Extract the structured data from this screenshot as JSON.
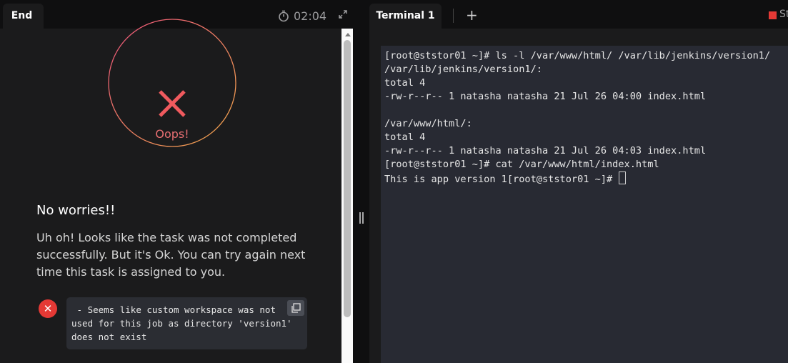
{
  "left_panel": {
    "tab_label": "End",
    "timer": "02:04",
    "result": {
      "status_text": "Oops!",
      "heading": "No worries!!",
      "message": "Uh oh! Looks like the task was not completed successfully. But it's Ok. You can try again next time this task is assigned to you.",
      "error_details": " - Seems like custom workspace was not used for this job as directory 'version1' does not exist"
    }
  },
  "right_panel": {
    "tabs": [
      {
        "label": "Terminal 1"
      }
    ],
    "add_tab_label": "+",
    "stop_label": "St",
    "terminal": {
      "lines": [
        "[root@ststor01 ~]# ls -l /var/www/html/ /var/lib/jenkins/version1/",
        "/var/lib/jenkins/version1/:",
        "total 4",
        "-rw-r--r-- 1 natasha natasha 21 Jul 26 04:00 index.html",
        "",
        "/var/www/html/:",
        "total 4",
        "-rw-r--r-- 1 natasha natasha 21 Jul 26 04:03 index.html",
        "[root@ststor01 ~]# cat /var/www/html/index.html",
        "This is app version 1[root@ststor01 ~]# "
      ]
    }
  },
  "colors": {
    "error_red": "#e53935",
    "oops_text": "#e86f72",
    "ring_gradient_start": "#e8507a",
    "ring_gradient_end": "#f0a84a",
    "terminal_bg": "#282a33"
  },
  "icons": {
    "timer": "stopwatch-icon",
    "expand": "expand-icon",
    "status": "close-x-icon",
    "error": "error-x-icon",
    "copy": "copy-icon",
    "divider": "resize-handle-icon"
  }
}
